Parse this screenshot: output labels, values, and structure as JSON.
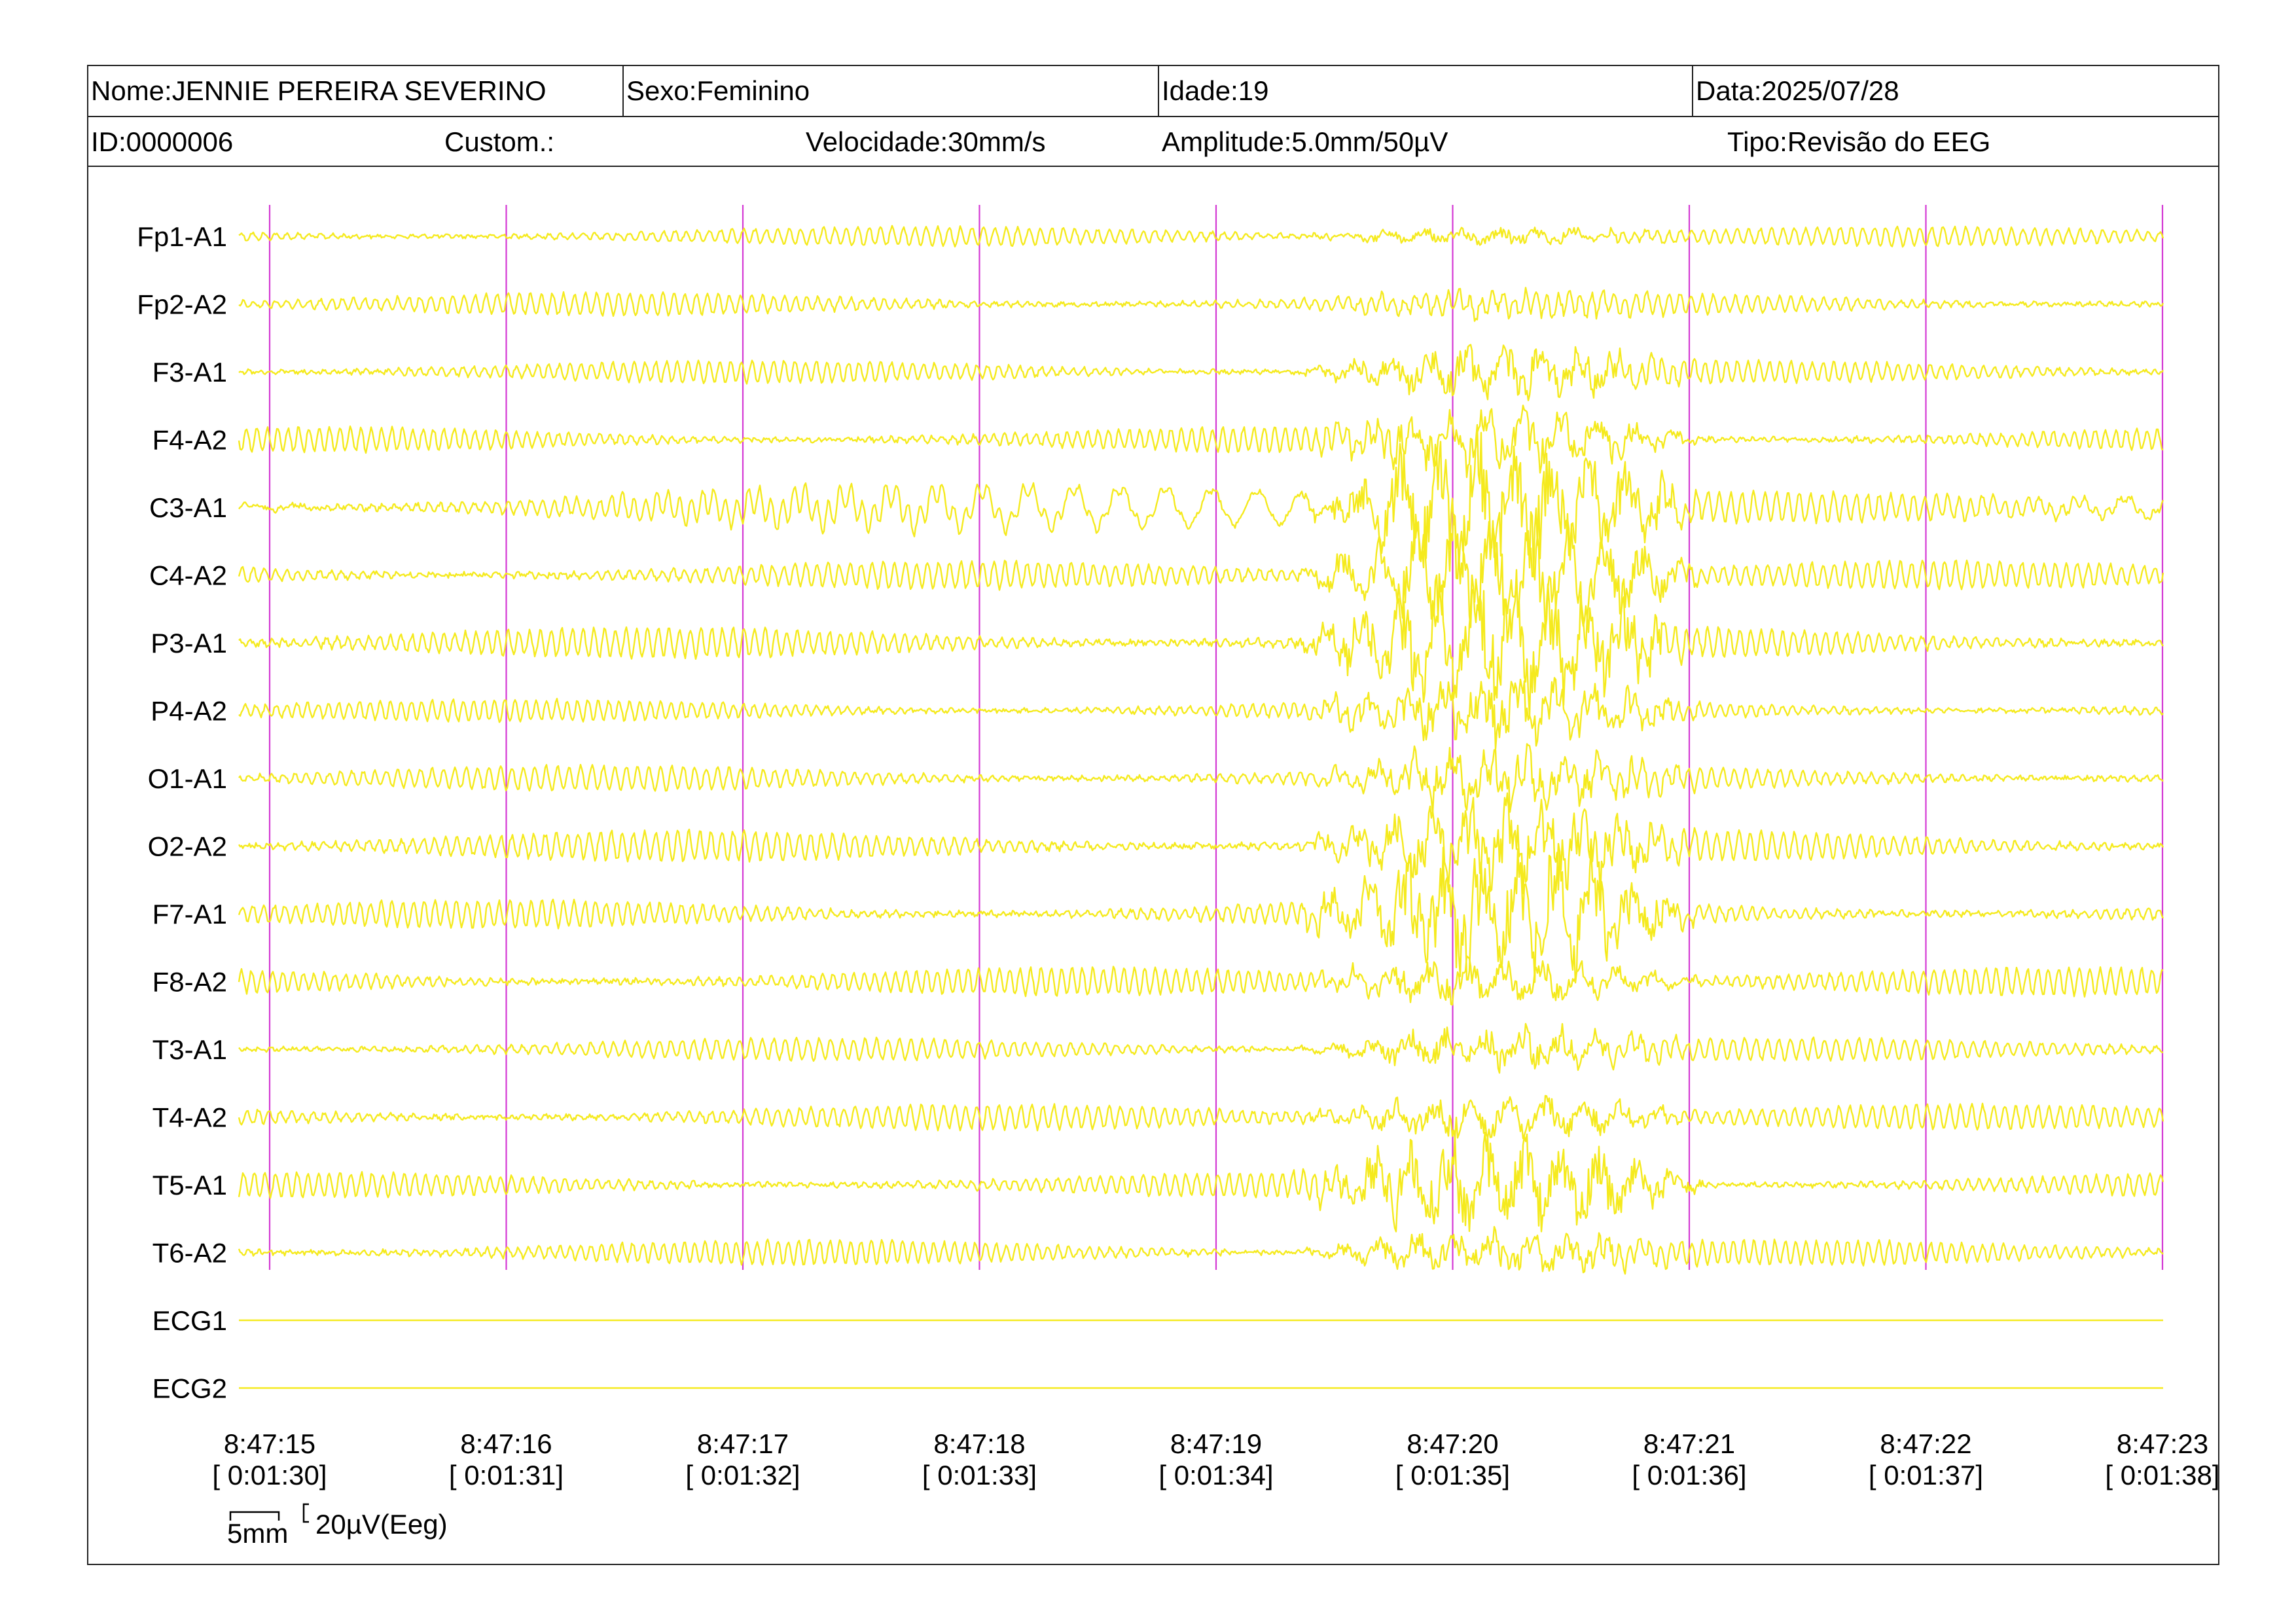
{
  "header": {
    "name": "Nome:JENNIE PEREIRA SEVERINO",
    "sex": "Sexo:Feminino",
    "age": "Idade:19",
    "date": "Data:2025/07/28",
    "id": "ID:0000006",
    "custom": "Custom.:",
    "speed": "Velocidade:30mm/s",
    "amplitude": "Amplitude:5.0mm/50µV",
    "type": "Tipo:Revisão do EEG"
  },
  "channels": [
    {
      "label": "Fp1-A1",
      "kind": "eeg"
    },
    {
      "label": "Fp2-A2",
      "kind": "eeg"
    },
    {
      "label": "F3-A1",
      "kind": "eeg"
    },
    {
      "label": "F4-A2",
      "kind": "eeg"
    },
    {
      "label": "C3-A1",
      "kind": "eeg"
    },
    {
      "label": "C4-A2",
      "kind": "eeg"
    },
    {
      "label": "P3-A1",
      "kind": "eeg"
    },
    {
      "label": "P4-A2",
      "kind": "eeg"
    },
    {
      "label": "O1-A1",
      "kind": "eeg"
    },
    {
      "label": "O2-A2",
      "kind": "eeg"
    },
    {
      "label": "F7-A1",
      "kind": "eeg"
    },
    {
      "label": "F8-A2",
      "kind": "eeg"
    },
    {
      "label": "T3-A1",
      "kind": "eeg"
    },
    {
      "label": "T4-A2",
      "kind": "eeg"
    },
    {
      "label": "T5-A1",
      "kind": "eeg"
    },
    {
      "label": "T6-A2",
      "kind": "eeg"
    },
    {
      "label": "ECG1",
      "kind": "flat"
    },
    {
      "label": "ECG2",
      "kind": "flat"
    }
  ],
  "time_markers": [
    {
      "clock": "8:47:15",
      "elapsed": "[ 0:01:30]"
    },
    {
      "clock": "8:47:16",
      "elapsed": "[ 0:01:31]"
    },
    {
      "clock": "8:47:17",
      "elapsed": "[ 0:01:32]"
    },
    {
      "clock": "8:47:18",
      "elapsed": "[ 0:01:33]"
    },
    {
      "clock": "8:47:19",
      "elapsed": "[ 0:01:34]"
    },
    {
      "clock": "8:47:20",
      "elapsed": "[ 0:01:35]"
    },
    {
      "clock": "8:47:21",
      "elapsed": "[ 0:01:36]"
    },
    {
      "clock": "8:47:22",
      "elapsed": "[ 0:01:37]"
    },
    {
      "clock": "8:47:23",
      "elapsed": "[ 0:01:38]"
    }
  ],
  "scale": {
    "time": "5mm",
    "amplitude": "20µV(Eeg)"
  },
  "colors": {
    "trace": "#f5ea1e",
    "marker": "#d43ad4",
    "border": "#222222"
  }
}
